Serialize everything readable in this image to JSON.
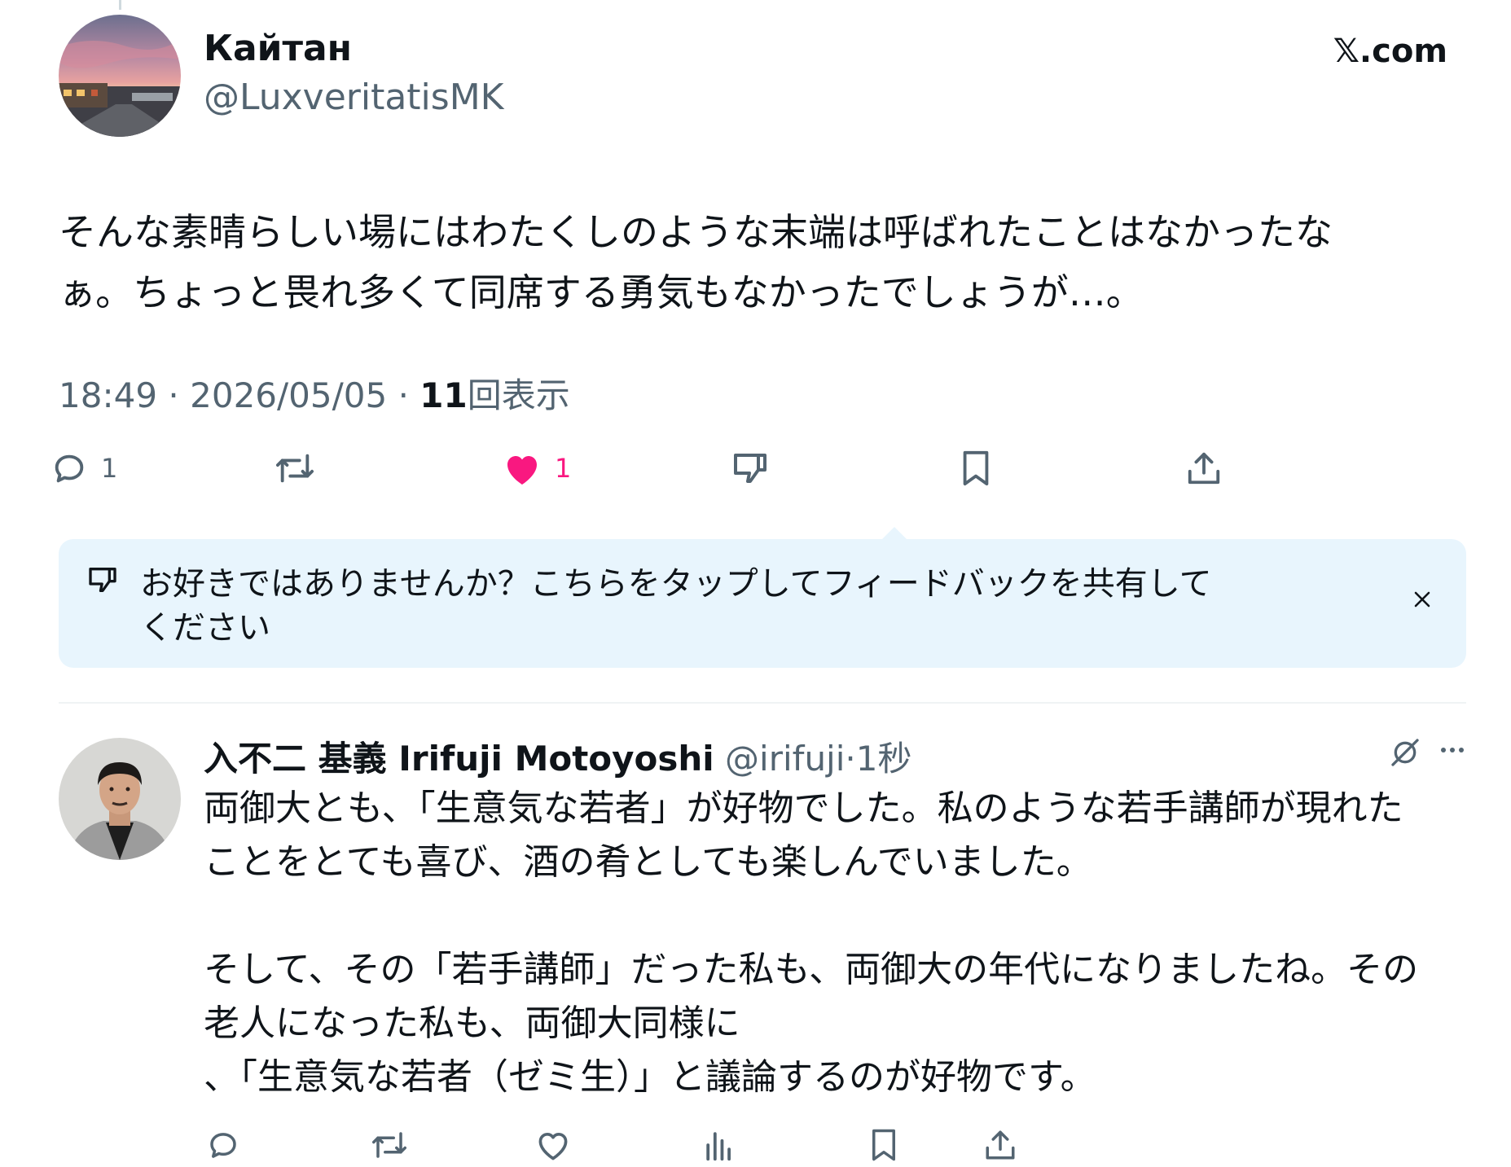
{
  "main_tweet": {
    "display_name": "Кайтан",
    "handle": "@LuxveritatisMK",
    "site": "𝕏.com",
    "text_lines": [
      "そんな素晴らしい場にはわたくしのような末端は呼ばれたことはなかったな",
      "ぁ。ちょっと畏れ多くて同席する勇気もなかったでしょうが…。"
    ],
    "time": "18:49",
    "date": "2026/05/05",
    "views_count": "11",
    "views_label": "回表示",
    "sep": "·",
    "actions": {
      "reply_count": "1",
      "like_count": "1"
    },
    "colors": {
      "like": "#f91880",
      "secondary": "#536471"
    }
  },
  "feedback_banner": {
    "lines": [
      "お好きではありませんか？こちらをタップしてフィードバックを共有して",
      "ください"
    ],
    "close_icon": "×",
    "background": "#e8f5fd"
  },
  "reply_tweet": {
    "display_name": "入不二 基義 Irifuji Motoyoshi",
    "handle": "@irifuji",
    "sep": "·",
    "time": "1秒",
    "text_lines": [
      "両御大とも、「生意気な若者」が好物でした。私のような若手講師が現れた",
      "ことをとても喜び、酒の肴としても楽しんでいました。",
      "",
      "そして、その「若手講師」だった私も、両御大の年代になりましたね。その",
      "老人になった私も、両御大同様に",
      "、「生意気な若者（ゼミ生）」と議論するのが好物です。"
    ]
  }
}
